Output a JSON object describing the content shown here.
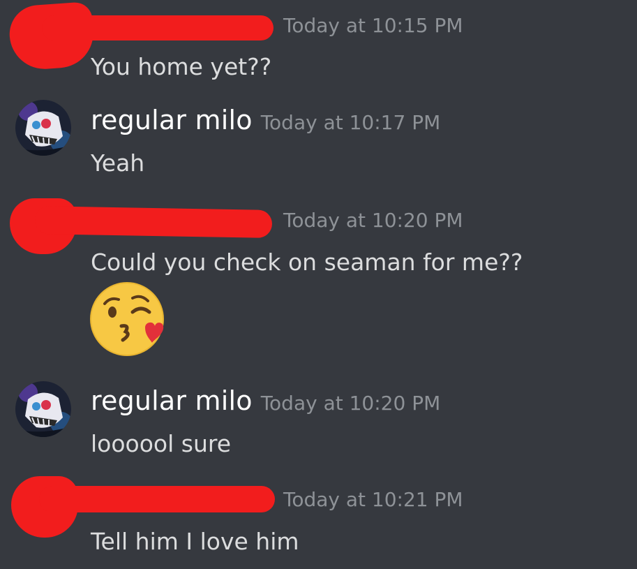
{
  "messages": [
    {
      "author": "",
      "timestamp": "Today at 10:15 PM",
      "text": "You home yet??",
      "redacted": true
    },
    {
      "author": "regular milo",
      "timestamp": "Today at 10:17 PM",
      "text": "Yeah",
      "avatar_icon": "skull-avatar-icon"
    },
    {
      "author": "",
      "timestamp": "Today at 10:20 PM",
      "text": "Could you check on seaman for me??",
      "redacted": true,
      "attachment_emoji": "face-throwing-kiss-emoji"
    },
    {
      "author": "regular milo",
      "timestamp": "Today at 10:20 PM",
      "text": "loooool sure",
      "avatar_icon": "skull-avatar-icon"
    },
    {
      "author": "",
      "timestamp": "Today at 10:21 PM",
      "text": "Tell him I love him",
      "redacted": true
    }
  ],
  "colors": {
    "background": "#36393f",
    "username": "#ffffff",
    "timestamp": "#8e9297",
    "message_text": "#dcddde",
    "redaction": "#f21d1d"
  }
}
